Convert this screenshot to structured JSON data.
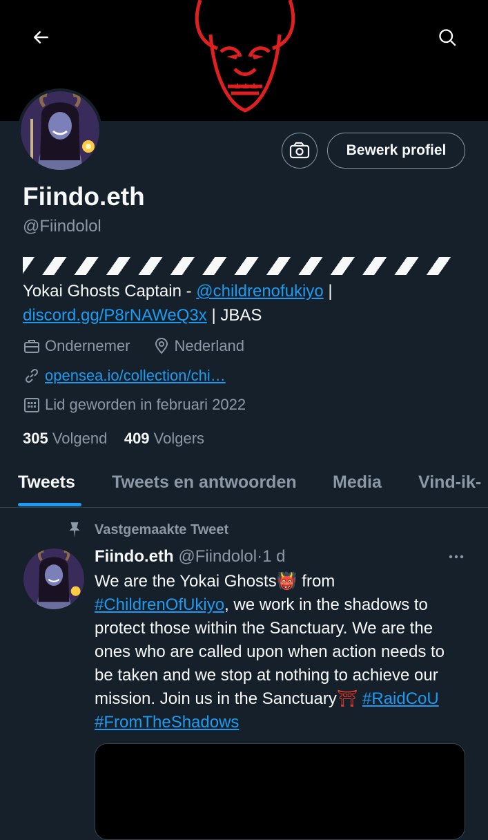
{
  "header": {
    "back_icon": "arrow-left-icon",
    "search_icon": "search-icon",
    "banner_image": "red oni demon mask"
  },
  "profile": {
    "name": "Fiindo.eth",
    "handle": "@Fiindolol",
    "edit_button": "Bewerk profiel",
    "camera_icon": "nft-camera-icon",
    "bio": {
      "text1": "Yokai Ghosts Captain - ",
      "mention": "@childrenofukiyo",
      "sep1": " | ",
      "link": "discord.gg/P8rNAWeQ3x",
      "text2": " | JBAS"
    },
    "category": "Ondernemer",
    "location": "Nederland",
    "website": "opensea.io/collection/chi…",
    "joined": "Lid geworden in februari 2022",
    "following_count": "305",
    "following_label": "Volgend",
    "followers_count": "409",
    "followers_label": "Volgers"
  },
  "tabs": [
    {
      "label": "Tweets",
      "active": true
    },
    {
      "label": "Tweets en antwoorden",
      "active": false
    },
    {
      "label": "Media",
      "active": false
    },
    {
      "label": "Vind-ik-",
      "active": false
    }
  ],
  "tweet": {
    "pinned_label": "Vastgemaakte Tweet",
    "author_name": "Fiindo.eth",
    "author_handle": "@Fiindolol",
    "dot": "·",
    "time": "1 d",
    "body_1": "We are the Yokai Ghosts",
    "emoji_oni": "👹",
    "body_2": "from",
    "hashtag_1": "#ChildrenOfUkiyo",
    "body_3": ", we work in the shadows to protect those within the Sanctuary. We are the ones who are called upon when action needs to be taken and we stop at nothing to achieve our mission. Join us in the Sanctuary",
    "emoji_torii": "⛩",
    "hashtag_2": "#RaidCoU",
    "hashtag_3": "#FromTheShadows"
  },
  "colors": {
    "background": "#15202b",
    "accent": "#1d9bf0",
    "secondary_text": "#8b98a5",
    "banner_red": "#e02020"
  }
}
